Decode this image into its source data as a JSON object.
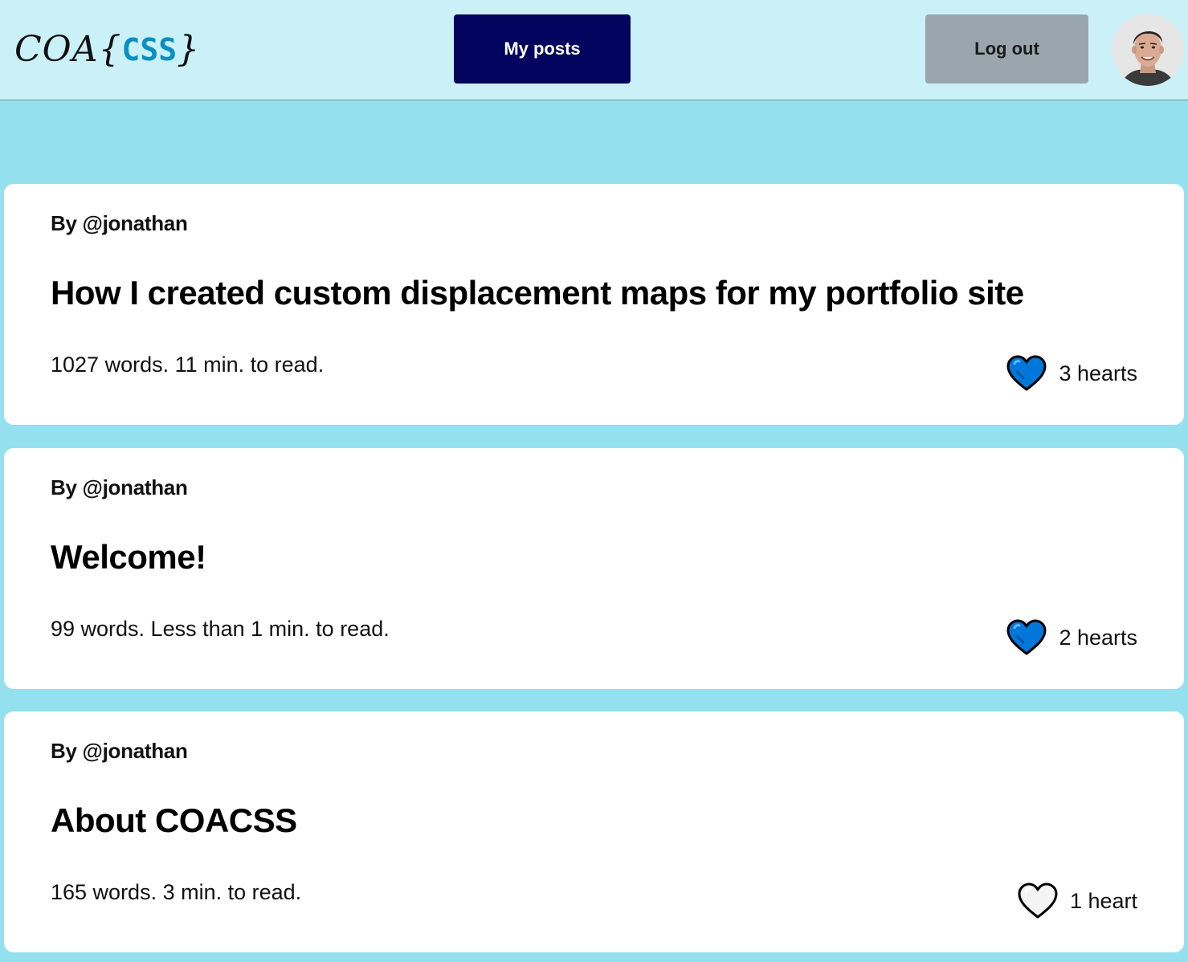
{
  "header": {
    "logo": {
      "hand": "COA",
      "open_brace": "{",
      "css": "CSS",
      "close_brace": "}"
    },
    "my_posts_label": "My posts",
    "logout_label": "Log out",
    "avatar_alt": "avatar-photo"
  },
  "colors": {
    "page_bg": "#94e0ef",
    "header_bg": "#caf0f8",
    "primary_button": "#03045e",
    "secondary_button": "#9aa6ad",
    "heart_filled": "#0077d9"
  },
  "posts": [
    {
      "author": "By @jonathan",
      "title": "How I created custom displacement maps for my portfolio site",
      "meta": "1027 words. 11 min. to read.",
      "hearts": "3 hearts",
      "liked": true
    },
    {
      "author": "By @jonathan",
      "title": "Welcome!",
      "meta": "99 words. Less than 1 min. to read.",
      "hearts": "2 hearts",
      "liked": true
    },
    {
      "author": "By @jonathan",
      "title": "About COACSS",
      "meta": "165 words. 3 min. to read.",
      "hearts": "1 heart",
      "liked": false
    }
  ]
}
